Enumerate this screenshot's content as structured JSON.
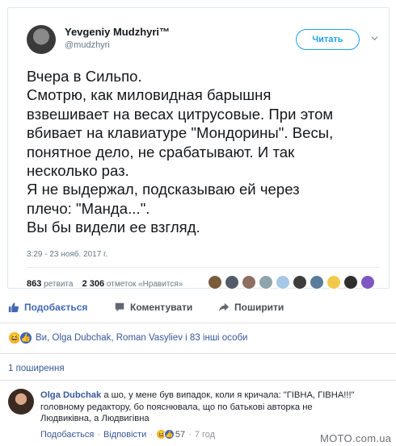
{
  "tweet": {
    "author_name": "Yevgeniy Mudzhyri™",
    "author_handle": "@mudzhyri",
    "follow_label": "Читать",
    "text_lines": [
      "Вчера в Сильпо.",
      "Смотрю, как миловидная барышня",
      "взвешивает на весах цитрусовые. При этом",
      "вбивает на клавиатуре \"Мондорины\". Весы,",
      "понятное дело, не срабатывают. И так",
      "несколько раз.",
      "Я не выдержал, подсказываю ей через",
      "плечо: \"Манда...\".",
      "Вы бы видели ее взгляд."
    ],
    "timestamp": "3:29 - 23 нояб. 2017 г.",
    "retweets_count": "863",
    "retweets_label": "ретвита",
    "likes_count": "2 306",
    "likes_label": "отметок «Нравится»",
    "liker_colors": [
      "#7a5b3c",
      "#555b66",
      "#8d6e63",
      "#90a4ae",
      "#a7c7e7",
      "#3d3d3d",
      "#5b7c99",
      "#f2c94c",
      "#2f2f2f",
      "#7e57c2"
    ]
  },
  "facebook": {
    "like_label": "Подобається",
    "comment_label": "Коментувати",
    "share_label": "Поширити",
    "reactions_text": "Ви, Olga Dubchak, Roman Vasyliev і 83 інші особи",
    "shares_text": "1 поширення",
    "comment": {
      "author": "Olga Dubchak",
      "text_lines": [
        " а шо, у мене був випадок, коли я кричала: \"ГІВНА, ГІВНА!!!\"",
        "головному редактору, бо пояснювала, що по батькові авторка не",
        "Людвиківна, а Людвигівна"
      ],
      "like_label": "Подобається",
      "reply_label": "Відповісти",
      "reaction_count": "57",
      "time": "7 год"
    }
  },
  "watermark": "MOTO.com.ua",
  "colors": {
    "twitter_blue": "#1da1f2",
    "fb_blue": "#4267b2",
    "fb_link": "#385898"
  }
}
